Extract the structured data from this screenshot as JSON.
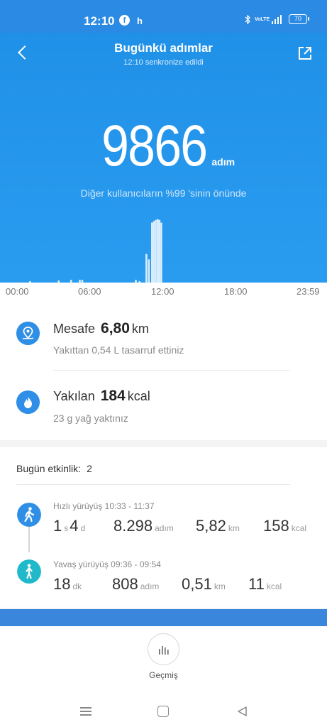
{
  "status_bar": {
    "time": "12:10",
    "fb": "f",
    "h": "h",
    "net": "VoLTE",
    "net2": "4G",
    "battery": "70"
  },
  "app_bar": {
    "title": "Bugünkü adımlar",
    "subtitle": "12:10 senkronize edildi"
  },
  "summary": {
    "steps": "9866",
    "steps_unit": "adım",
    "comparison": "Diğer kullanıcıların %99 'sinin önünde"
  },
  "chart_data": {
    "type": "bar",
    "x_tick_labels": [
      "00:00",
      "06:00",
      "12:00",
      "18:00",
      "23:59"
    ],
    "series_description_values": [],
    "bars": [
      {
        "hour": 1.2,
        "value": 2
      },
      {
        "hour": 3.5,
        "value": 3
      },
      {
        "hour": 4.5,
        "value": 4
      },
      {
        "hour": 5.2,
        "value": 4
      },
      {
        "hour": 5.4,
        "value": 4
      },
      {
        "hour": 9.7,
        "value": 4
      },
      {
        "hour": 10.0,
        "value": 2
      },
      {
        "hour": 10.55,
        "value": 42
      },
      {
        "hour": 10.75,
        "value": 34
      },
      {
        "hour": 11.0,
        "value": 88
      },
      {
        "hour": 11.15,
        "value": 90
      },
      {
        "hour": 11.3,
        "value": 92
      },
      {
        "hour": 11.45,
        "value": 93
      },
      {
        "hour": 11.6,
        "value": 92
      },
      {
        "hour": 11.75,
        "value": 88
      }
    ],
    "ylim": [
      0,
      100
    ]
  },
  "distance": {
    "label": "Mesafe",
    "value": "6,80",
    "unit": "km",
    "detail": "Yakıttan 0,54 L tasarruf ettiniz"
  },
  "calories": {
    "label": "Yakılan",
    "value": "184",
    "unit": "kcal",
    "detail": "23 g yağ yaktınız"
  },
  "activities": {
    "header": "Bugün etkinlik:",
    "count": "2",
    "items": [
      {
        "title": "Hızlı yürüyüş 10:33 - 11:37",
        "dur_a": "1",
        "dur_a_unit": "s",
        "dur_b": "4",
        "dur_b_unit": "d",
        "steps": "8.298",
        "steps_unit": "adım",
        "dist": "5,82",
        "dist_unit": "km",
        "kcal": "158",
        "kcal_unit": "kcal",
        "color": "#2f8ee6"
      },
      {
        "title": "Yavaş yürüyüş 09:36 - 09:54",
        "dur_a": "18",
        "dur_a_unit": "dk",
        "steps": "808",
        "steps_unit": "adım",
        "dist": "0,51",
        "dist_unit": "km",
        "kcal": "11",
        "kcal_unit": "kcal",
        "color": "#1fb9c9"
      }
    ]
  },
  "bottom": {
    "history_label": "Geçmiş"
  },
  "colors": {
    "primary": "#2a96ec",
    "strip": "#3b86dd"
  }
}
